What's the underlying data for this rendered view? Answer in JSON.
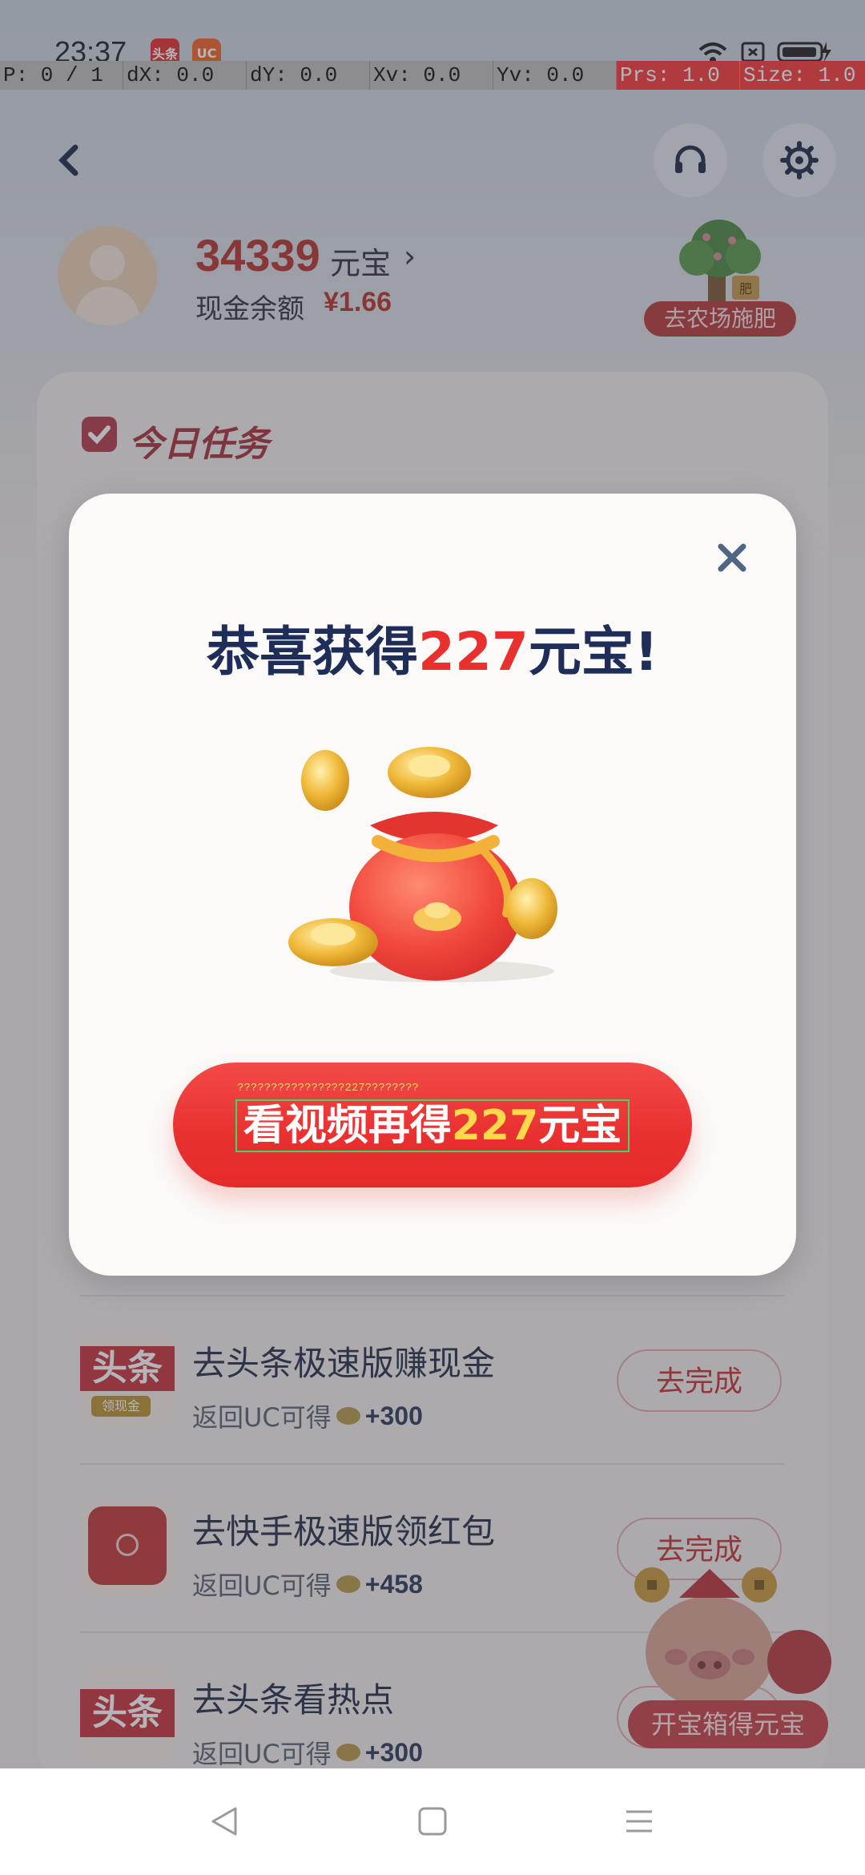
{
  "status_bar": {
    "time": "23:37",
    "app_icon_1": "头条",
    "app_icon_2": "UC"
  },
  "debug_overlay": {
    "p": "P: 0 / 1",
    "dx": "dX: 0.0",
    "dy": "dY: 0.0",
    "xv": "Xv: 0.0",
    "yv": "Yv: 0.0",
    "prs": "Prs: 1.0",
    "size": "Size: 1.0"
  },
  "header": {
    "back_icon": "chevron-left-icon",
    "service_icon": "headset-icon",
    "settings_icon": "gear-icon"
  },
  "account": {
    "ingot_amount": "34339",
    "ingot_unit": "元宝",
    "cash_label": "现金余额",
    "cash_value": "¥1.66",
    "farm_button": "去农场施肥",
    "farm_sign": "肥"
  },
  "tasks": {
    "title": "今日任务",
    "items": [
      {
        "name": "去头条极速版赚现金",
        "reward_label": "返回UC可得",
        "reward_amount": "+300",
        "button": "去完成",
        "icon_text": "头条",
        "icon_sub": "领现金"
      },
      {
        "name": "去快手极速版领红包",
        "reward_label": "返回UC可得",
        "reward_amount": "+458",
        "button": "去完成",
        "icon_text": ""
      },
      {
        "name": "去头条看热点",
        "reward_label": "返回UC可得",
        "reward_amount": "+300",
        "button": "去完成",
        "icon_text": "头条"
      }
    ]
  },
  "treasure": {
    "button": "开宝箱得元宝"
  },
  "dialog": {
    "title_prefix": "恭喜获得",
    "title_amount": "227",
    "title_suffix": "元宝!",
    "cta_tiny_text": "????????????????227????????",
    "cta_prefix": "看视频再得",
    "cta_amount": "227",
    "cta_suffix": "元宝",
    "close_icon": "close-icon"
  },
  "nav_bar": {
    "back_icon": "triangle-back-icon",
    "home_icon": "square-home-icon",
    "menu_icon": "menu-lines-icon"
  },
  "colors": {
    "accent_red": "#e8302f",
    "title_navy": "#1f2d59",
    "highlight_yellow": "#ffd94a"
  }
}
